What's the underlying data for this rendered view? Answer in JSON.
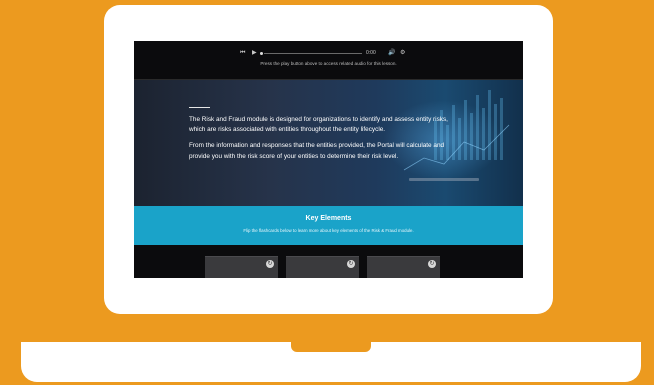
{
  "audio": {
    "rewind_icon": "rewind-icon",
    "play_icon": "play-icon",
    "time": "0:00",
    "caption": "Press the play button above to access related audio for this lesson."
  },
  "hero": {
    "paragraph1": "The Risk and Fraud module is designed for organizations to identify and assess entity risks, which are risks associated with entities throughout the entity lifecycle.",
    "paragraph2": "From the information and responses that the entities provided, the Portal will calculate and provide you with the risk score of your entities to determine their risk level."
  },
  "key_elements": {
    "title": "Key Elements",
    "subtitle": "Flip the flashcards below to learn more about key elements of the Risk & Fraud module."
  },
  "cards": [
    {
      "icon": "flip-icon"
    },
    {
      "icon": "flip-icon"
    },
    {
      "icon": "flip-icon"
    }
  ],
  "colors": {
    "background": "#ec9a1f",
    "band": "#1aa3c9"
  }
}
